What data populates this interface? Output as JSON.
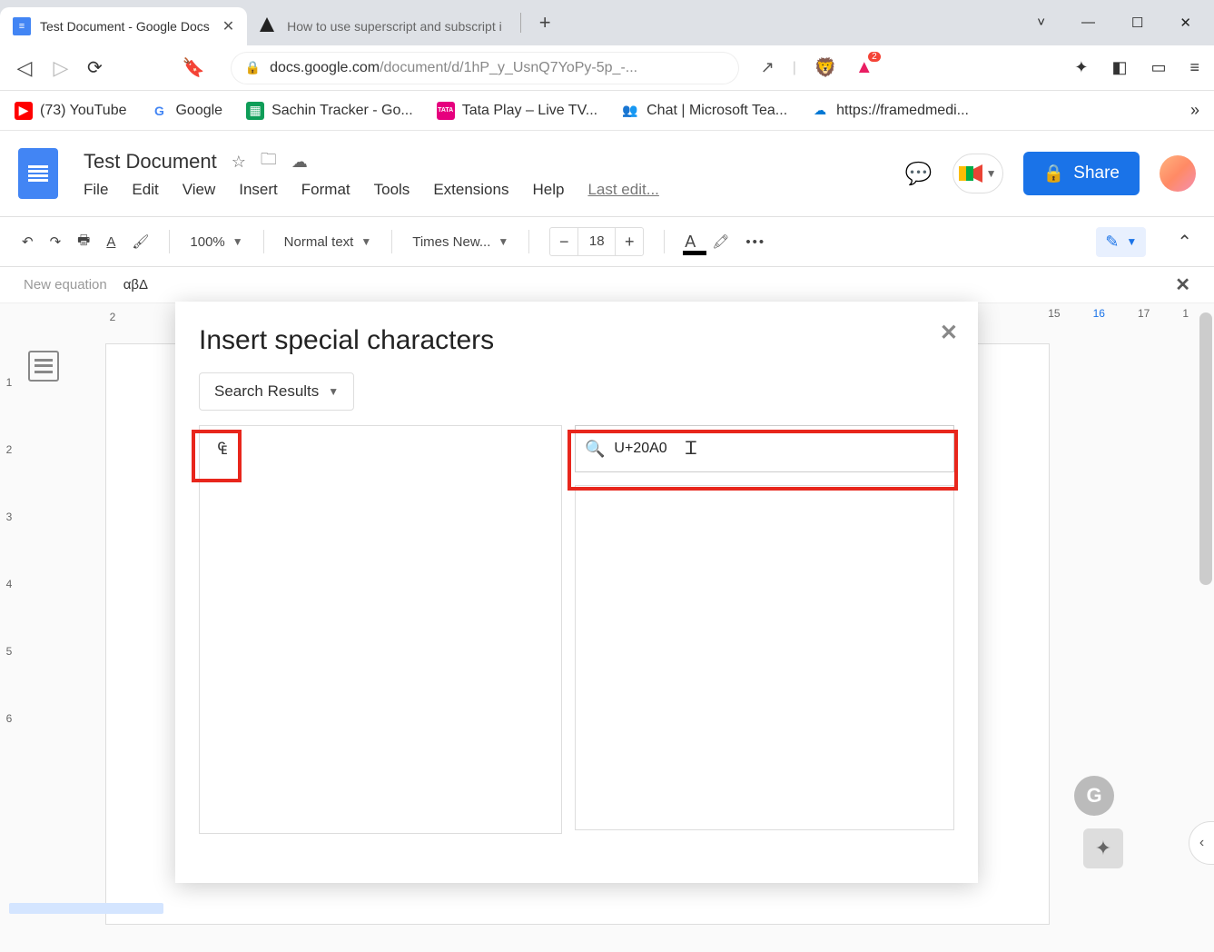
{
  "browser": {
    "tabs": [
      {
        "title": "Test Document - Google Docs",
        "active": true
      },
      {
        "title": "How to use superscript and subscript i",
        "active": false
      }
    ],
    "url_host": "docs.google.com",
    "url_path": "/document/d/1hP_y_UsnQ7YoPy-5p_-...",
    "triangle_badge": "2"
  },
  "bookmarks": [
    {
      "label": "(73) YouTube"
    },
    {
      "label": "Google"
    },
    {
      "label": "Sachin Tracker - Go..."
    },
    {
      "label": "Tata Play – Live TV..."
    },
    {
      "label": "Chat | Microsoft Tea..."
    },
    {
      "label": "https://framedmedi..."
    }
  ],
  "docs": {
    "title": "Test Document",
    "menus": [
      "File",
      "Edit",
      "View",
      "Insert",
      "Format",
      "Tools",
      "Extensions",
      "Help"
    ],
    "last_edit": "Last edit...",
    "share": "Share"
  },
  "toolbar": {
    "zoom": "100%",
    "style": "Normal text",
    "font": "Times New...",
    "size": "18"
  },
  "equation_bar": {
    "label": "New equation",
    "symbols": "αβΔ"
  },
  "ruler": {
    "top_visible": [
      "2"
    ],
    "top_right": [
      "15",
      "16",
      "17",
      "1"
    ],
    "left": [
      "1",
      "2",
      "3",
      "4",
      "5",
      "6"
    ]
  },
  "modal": {
    "title": "Insert special characters",
    "category": "Search Results",
    "search_value": "U+20A0",
    "result_char": "₠"
  }
}
